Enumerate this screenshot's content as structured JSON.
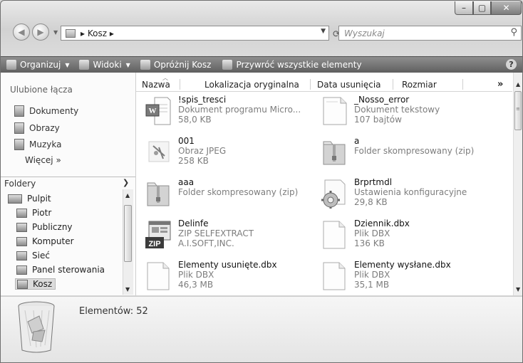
{
  "window": {
    "controls": {
      "min": "–",
      "max": "▢",
      "close": "✕"
    }
  },
  "navbar": {
    "back": "◀",
    "forward": "▶",
    "address_crumbs": [
      "▸ Kosz ▸"
    ],
    "search_placeholder": "Wyszukaj"
  },
  "toolbar": {
    "items": [
      "Organizuj",
      "Widoki",
      "Opróżnij Kosz",
      "Przywróć wszystkie elementy"
    ],
    "help": "?"
  },
  "sidebar": {
    "favorites_title": "Ulubione łącza",
    "favorites": [
      "Dokumenty",
      "Obrazy",
      "Muzyka"
    ],
    "more": "Więcej  »",
    "folders_title": "Foldery",
    "tree": [
      "Pulpit",
      "Piotr",
      "Publiczny",
      "Komputer",
      "Sieć",
      "Panel sterowania",
      "Kosz"
    ],
    "selected": "Kosz"
  },
  "columns": [
    "Nazwa",
    "Lokalizacja oryginalna",
    "Data usunięcia",
    "Rozmiar"
  ],
  "files": [
    {
      "name": "!spis_tresci",
      "line2": "Dokument programu Micro...",
      "line3": "58,0 KB",
      "icon": "word-document-icon"
    },
    {
      "name": "_Nosso_error",
      "line2": "Dokument tekstowy",
      "line3": "107 bajtów",
      "icon": "text-document-icon"
    },
    {
      "name": "001",
      "line2": "Obraz JPEG",
      "line3": "258 KB",
      "icon": "image-thumbnail-icon"
    },
    {
      "name": "a",
      "line2": "Folder skompresowany (zip)",
      "line3": "",
      "icon": "zip-folder-icon"
    },
    {
      "name": "aaa",
      "line2": "Folder skompresowany (zip)",
      "line3": "",
      "icon": "zip-folder-icon"
    },
    {
      "name": "Brprtmdl",
      "line2": "Ustawienia konfiguracyjne",
      "line3": "29,8 KB",
      "icon": "config-gear-icon"
    },
    {
      "name": "Delinfe",
      "line2": "ZIP SELFEXTRACT",
      "line3": "A.I.SOFT,INC.",
      "icon": "zip-selfextract-icon"
    },
    {
      "name": "Dziennik.dbx",
      "line2": "Plik DBX",
      "line3": "136 KB",
      "icon": "generic-file-icon"
    },
    {
      "name": "Elementy usunięte.dbx",
      "line2": "Plik DBX",
      "line3": "46,3 MB",
      "icon": "generic-file-icon"
    },
    {
      "name": "Elementy wysłane.dbx",
      "line2": "Plik DBX",
      "line3": "35,1 MB",
      "icon": "generic-file-icon"
    }
  ],
  "details": {
    "count_text": "Elementów: 52"
  }
}
